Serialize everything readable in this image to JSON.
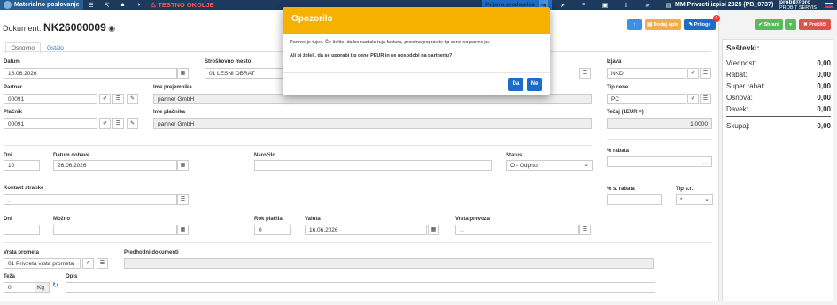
{
  "topbar": {
    "module": "Materialno poslovanje",
    "warning": "⚠ TESTNO OKOLJE",
    "login_button": "Prijava prodajalca",
    "company": "MM Privzeti izpisi 2025 (PB_0737)",
    "user_name": "probit@pro",
    "user_org": "PROBIT SERVIS"
  },
  "document": {
    "prefix": "Dokument:",
    "number": "NK26000009",
    "tabs": [
      "Osnovno",
      "Ostalo"
    ]
  },
  "actions": {
    "copy_label": "Dodaj opis",
    "attachments_label": "Priloge",
    "attachments_count": "0",
    "save_label": "Shrani",
    "cancel_label": "Prekliči"
  },
  "form": {
    "datum_label": "Datum",
    "datum": "16.06.2026",
    "strosek_label": "Stroškovno mesto",
    "strosek": "01 LESNI OBRAT",
    "izjava_label": "Izjava",
    "izjava": "NKD",
    "partner_label": "Partner",
    "partner": "00091",
    "prejemnik_label": "Ime prejemnika",
    "prejemnik": "partner GmbH",
    "tipcene_label": "Tip cene",
    "tipcene": "PC",
    "placnik_label": "Plačnik",
    "placnik": "00091",
    "imeplacnika_label": "Ime plačnika",
    "imeplacnika": "partner GmbH",
    "tecaj_label": "Tečaj (1EUR =)",
    "tecaj": "1,0000",
    "dni_label": "Dni",
    "dni": "10",
    "datumdobave_label": "Datum dobave",
    "datumdobave": "26.06.2026",
    "narocilo_label": "Naročilo",
    "status_label": "Status",
    "status": "O - Odprto",
    "rabat_label": "% rabata",
    "kontakt_label": "Kontakt stranke",
    "kontakt_placeholder": "...",
    "srabat_label": "% s. rabata",
    "tipsr_label": "Tip s.r.",
    "tipsr": "*",
    "dni2_label": "Dni",
    "mozno_label": "Možno",
    "rok_label": "Rok plačila",
    "rok": "0",
    "valuta_label": "Valuta",
    "valuta": "16.06.2026",
    "vrstaprevoza_label": "Vrsta prevoza",
    "vrstaprevoza_placeholder": "...",
    "vrstaprometa_label": "Vrsta prometa",
    "vrstaprometa": "01 Privzeta vrsta prometa",
    "predhodni_label": "Predhodni dokumenti",
    "teza_label": "Teža",
    "teza": "0",
    "teza_unit": "Kg",
    "opis_label": "Opis"
  },
  "summary": {
    "title": "Seštevki:",
    "rows": [
      {
        "label": "Vrednost:",
        "value": "0,00"
      },
      {
        "label": "Rabat:",
        "value": "0,00"
      },
      {
        "label": "Super rabat:",
        "value": "0,00"
      },
      {
        "label": "Osnova:",
        "value": "0,00"
      },
      {
        "label": "Davek:",
        "value": "0,00"
      }
    ],
    "total_label": "Skupaj:",
    "total_value": "0,00"
  },
  "modal": {
    "title": "Opozorilo",
    "message": "Partner je tujec. Če želite, da bo nastala tuja faktura, prosimo popravite tip cene na partnerju.",
    "question": "Ali bi želeli, da se uporabi tip cene PEUR in se posodobi na partnerju?",
    "yes": "Da",
    "no": "Ne"
  },
  "colors": {
    "topbar": "#1b3a5c",
    "accent": "#1e6bc9",
    "warning": "#f5b000",
    "save": "#5cb85c",
    "cancel": "#d9534f"
  }
}
